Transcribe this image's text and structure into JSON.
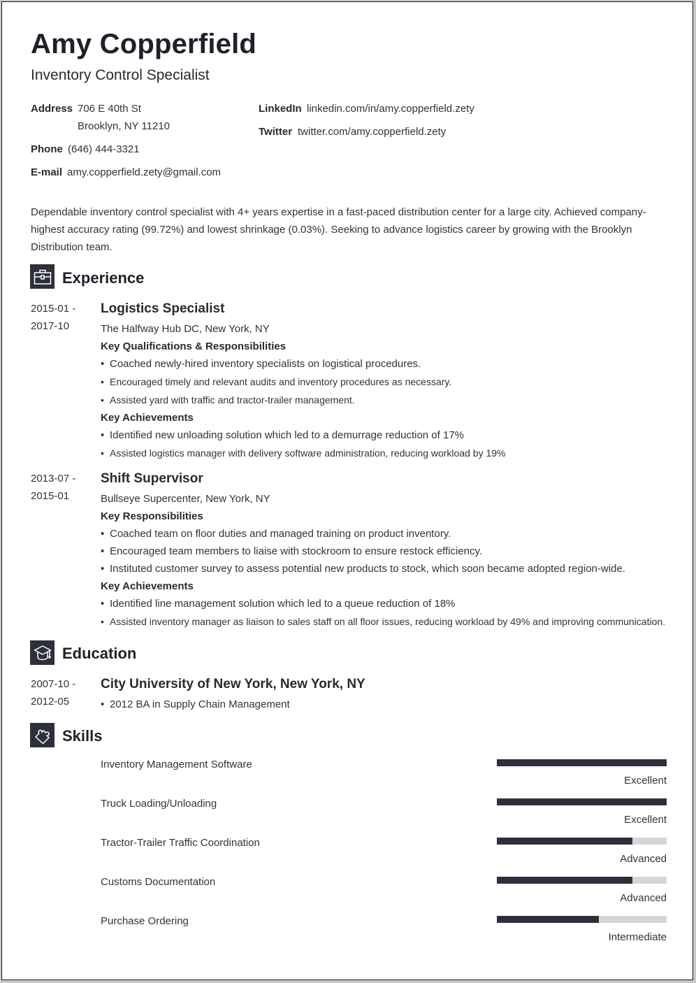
{
  "header": {
    "name": "Amy Copperfield",
    "title": "Inventory Control Specialist"
  },
  "contact": {
    "address_label": "Address",
    "address_line1": "706 E 40th St",
    "address_line2": "Brooklyn, NY 11210",
    "phone_label": "Phone",
    "phone": "(646) 444-3321",
    "email_label": "E-mail",
    "email": "amy.copperfield.zety@gmail.com",
    "linkedin_label": "LinkedIn",
    "linkedin": "linkedin.com/in/amy.copperfield.zety",
    "twitter_label": "Twitter",
    "twitter": "twitter.com/amy.copperfield.zety"
  },
  "summary": "Dependable inventory control specialist with 4+ years expertise in a fast-paced distribution center for a large city. Achieved company-highest accuracy rating (99.72%) and lowest shrinkage (0.03%). Seeking to advance logistics career by growing with the Brooklyn Distribution team.",
  "sections": {
    "experience": "Experience",
    "education": "Education",
    "skills": "Skills"
  },
  "experience": [
    {
      "date_start": "2015-01 -",
      "date_end": "2017-10",
      "position": "Logistics Specialist",
      "company": "The Halfway Hub DC, New York, NY",
      "resp_heading": "Key Qualifications & Responsibilities",
      "responsibilities": [
        "Coached newly-hired inventory specialists on logistical procedures.",
        "Encouraged timely and relevant audits and inventory procedures as necessary.",
        "Assisted yard with traffic and tractor-trailer management."
      ],
      "ach_heading": "Key Achievements",
      "achievements": [
        "Identified new unloading solution which led to a demurrage reduction of 17%",
        "Assisted logistics manager with delivery software administration, reducing workload by 19%"
      ]
    },
    {
      "date_start": "2013-07 -",
      "date_end": "2015-01",
      "position": "Shift Supervisor",
      "company": "Bullseye Supercenter, New York, NY",
      "resp_heading": "Key Responsibilities",
      "responsibilities": [
        "Coached team on floor duties and managed training on product inventory.",
        "Encouraged team members to liaise with stockroom to ensure restock efficiency.",
        "Instituted customer survey to assess potential new products to stock, which soon became adopted region-wide."
      ],
      "ach_heading": "Key Achievements",
      "achievements": [
        "Identified line management solution which led to a queue reduction of 18%",
        "Assisted inventory manager as liaison to sales staff on all floor issues, reducing workload by 49% and improving communication."
      ]
    }
  ],
  "education": [
    {
      "date_start": "2007-10 -",
      "date_end": "2012-05",
      "school": "City University of New York, New York, NY",
      "details": [
        "2012 BA in Supply Chain Management"
      ]
    }
  ],
  "skills": [
    {
      "name": "Inventory Management Software",
      "level": "Excellent",
      "fraction": 1.0
    },
    {
      "name": "Truck Loading/Unloading",
      "level": "Excellent",
      "fraction": 1.0
    },
    {
      "name": "Tractor-Trailer Traffic Coordination",
      "level": "Advanced",
      "fraction": 0.8
    },
    {
      "name": "Customs Documentation",
      "level": "Advanced",
      "fraction": 0.8
    },
    {
      "name": "Purchase Ordering",
      "level": "Intermediate",
      "fraction": 0.6
    }
  ],
  "colors": {
    "accent": "#2d303b",
    "bar_track": "#d6d6d6"
  }
}
